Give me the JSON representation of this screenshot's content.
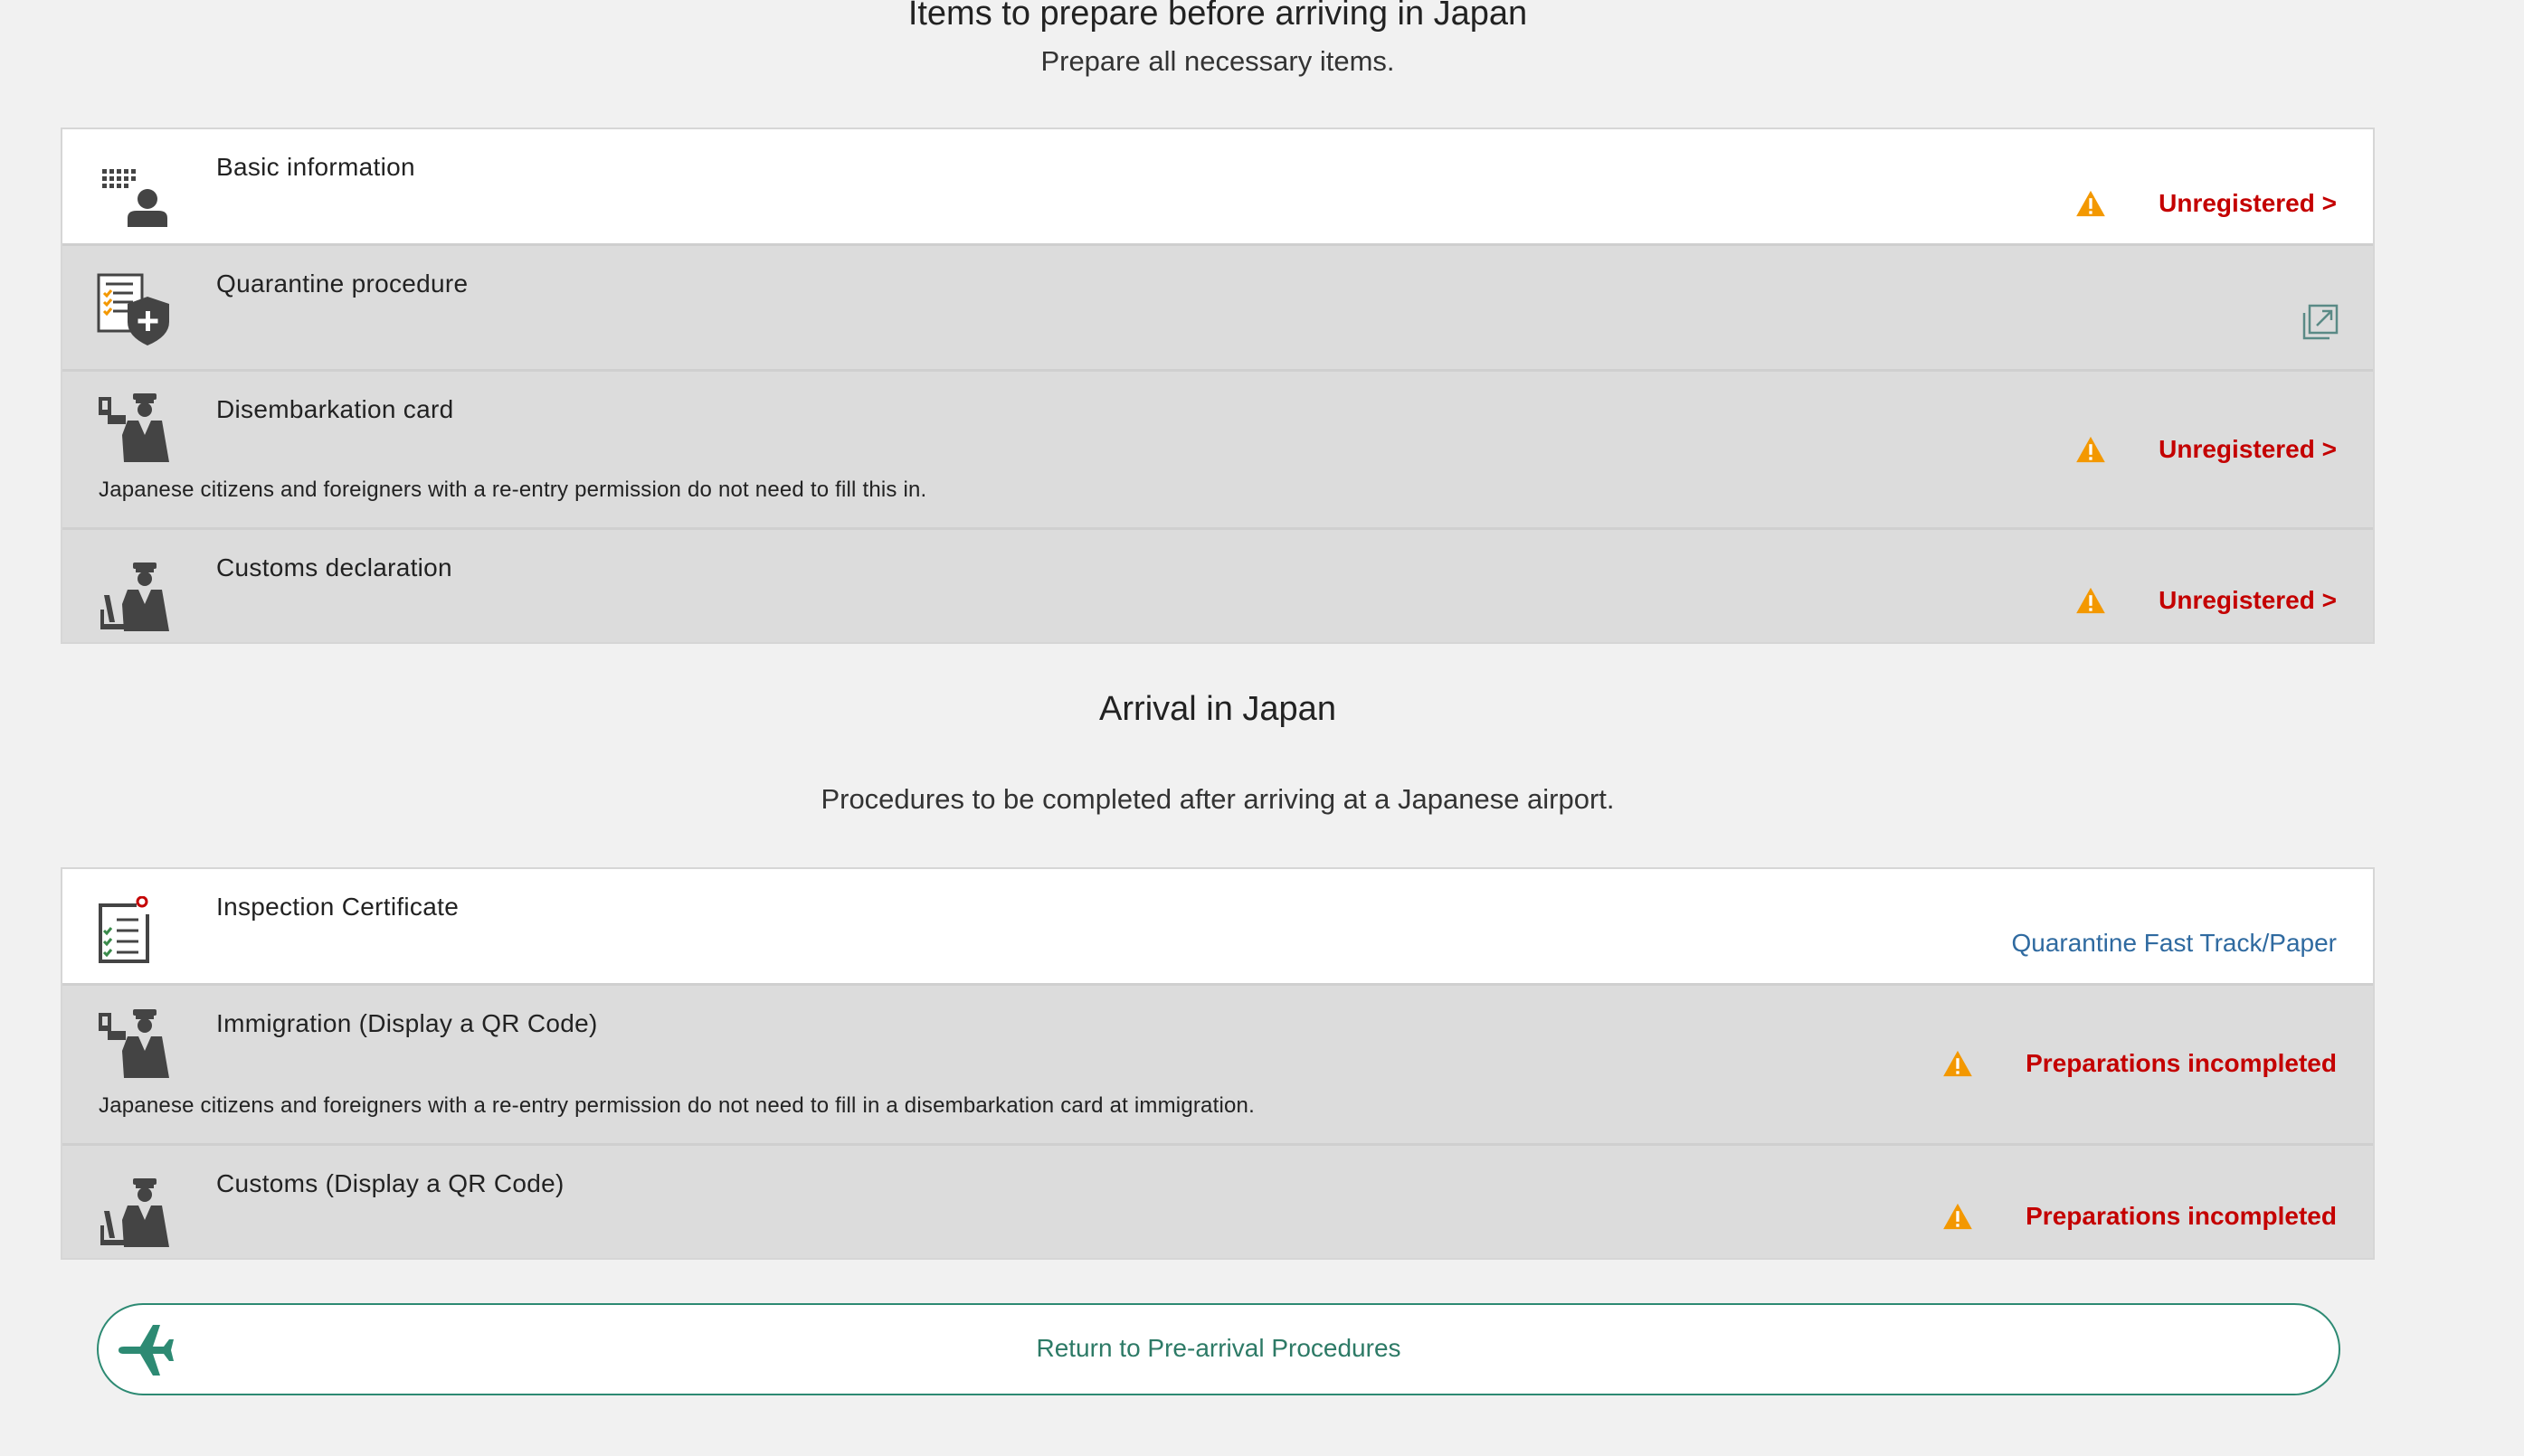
{
  "prepare": {
    "title": "Items to prepare before arriving in Japan",
    "subtitle": "Prepare all necessary items.",
    "items": [
      {
        "title": "Basic information",
        "status": "Unregistered >"
      },
      {
        "title": "Quarantine procedure"
      },
      {
        "title": "Disembarkation card",
        "status": "Unregistered >",
        "note": "Japanese citizens and foreigners with a re-entry permission do not need to fill this in."
      },
      {
        "title": "Customs declaration",
        "status": "Unregistered >"
      }
    ]
  },
  "arrival": {
    "title": "Arrival in Japan",
    "subtitle": "Procedures to be completed after arriving at a Japanese airport.",
    "items": [
      {
        "title": "Inspection Certificate",
        "link": "Quarantine Fast Track/Paper"
      },
      {
        "title": "Immigration (Display a QR Code)",
        "status": "Preparations incompleted",
        "note": "Japanese citizens and foreigners with a re-entry permission do not need to fill in a disembarkation card at immigration."
      },
      {
        "title": "Customs (Display a QR Code)",
        "status": "Preparations incompleted"
      }
    ]
  },
  "return_button": {
    "label": "Return to Pre-arrival Procedures"
  },
  "colors": {
    "status_red": "#c40000",
    "warning_orange": "#f39800",
    "link_blue": "#2f6aa0",
    "accent_green": "#2d8a73"
  },
  "icons": [
    "id-person-icon",
    "quarantine-shield-icon",
    "officer-passport-icon",
    "officer-laptop-icon",
    "checklist-icon",
    "warning-icon",
    "external-link-icon",
    "airplane-icon"
  ]
}
